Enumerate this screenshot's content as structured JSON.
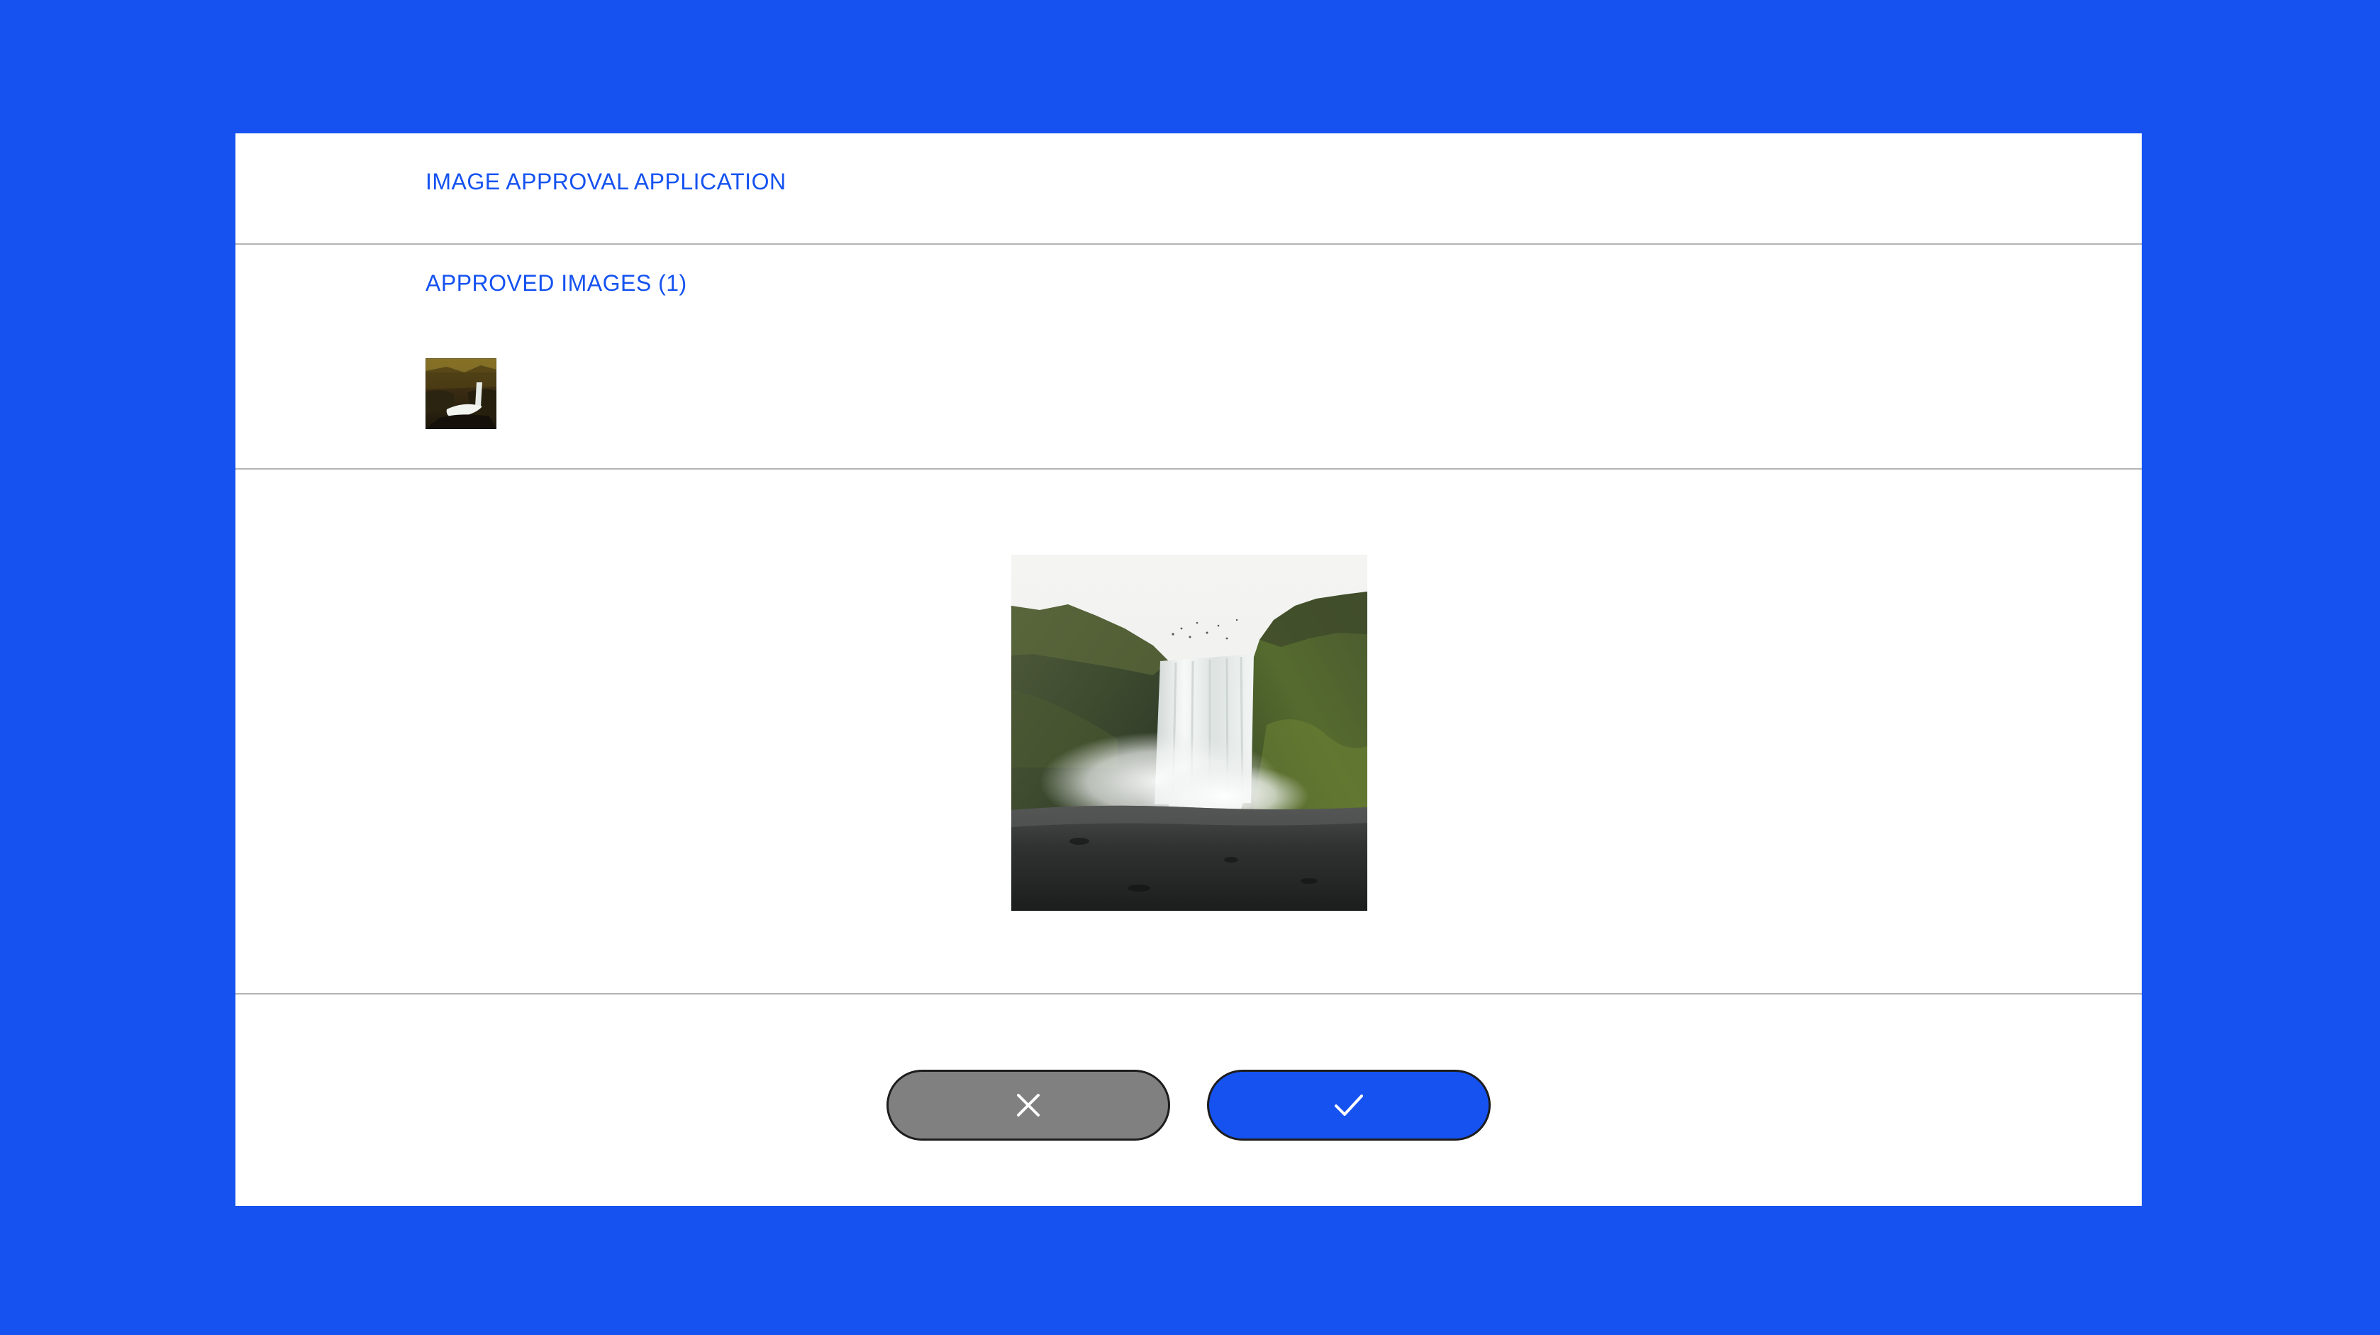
{
  "app": {
    "title": "IMAGE APPROVAL APPLICATION"
  },
  "approved": {
    "heading": "APPROVED IMAGES (1)",
    "thumbnails": [
      {
        "icon": "waterfall-thumbnail-image"
      }
    ]
  },
  "preview": {
    "icon": "waterfall-photo"
  },
  "actions": {
    "reject_icon": "close-icon",
    "approve_icon": "check-icon"
  },
  "colors": {
    "background": "#1552f0",
    "accent": "#1552f0",
    "reject_button": "#808080",
    "approve_button": "#1552f0",
    "card": "#ffffff",
    "divider": "#b4b4b4"
  }
}
